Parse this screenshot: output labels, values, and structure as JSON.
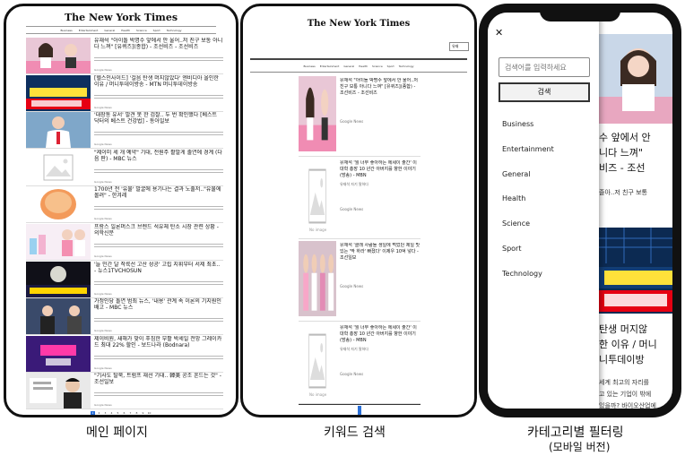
{
  "colors": {
    "accent": "#2a6fd8",
    "frame": "#111111"
  },
  "captions": {
    "screen1": "메인 페이지",
    "screen2": "키워드 검색",
    "screen3_line1": "카테고리별 필터링",
    "screen3_line2": "(모바일 버전)"
  },
  "screen1": {
    "logo": "The New York Times",
    "nav": [
      "Business",
      "Entertainment",
      "General",
      "Health",
      "Science",
      "Sport",
      "Technology"
    ],
    "articles": [
      {
        "title": "유재석 \"아이돌 박명수 앞에서 안 울어..저 친구 보통 아니다 느껴\" [유퀴즈](종합) - 조선비즈 - 조선비즈",
        "thumb": "people-pink",
        "source": "Google News"
      },
      {
        "title": "[헬스인사이드] '걸음 탄생 머지않았다' 엔비디아 올인한 이유 / 머니투데이방송 - MTN 머니투데이방송",
        "thumb": "banner-blue",
        "source": "Google News"
      },
      {
        "title": "'대장동 유서' 발견 못 한 검찰.. 두 번 확인했다 [베스트 닥터의 베스트 건강법] - 동아일보",
        "thumb": "doctor",
        "source": "Google News"
      },
      {
        "title": "\"제이미 세 개 예약\" 기대, 전원주 활발게 출연에 경계 (다음 판) - MBC 뉴스",
        "thumb": "no-image",
        "source": "Google News"
      },
      {
        "title": "1700년 전 '유물' 발굴에 용기나는 결과 노출저..\"유물에 몰려\" - 한겨레",
        "thumb": "orange-disc",
        "source": "Google News"
      },
      {
        "title": "프랑스 일론머스크 브렌드 석유체 탄소 시장 관련 상황 - 의학신문",
        "thumb": "lab",
        "source": "Google News"
      },
      {
        "title": "'늘 민간 달 착륙선 고산 성공' 고립 지휘부터 서제 최초.. - 뉴스1TVCHOSUN",
        "thumb": "moon",
        "source": "Google News"
      },
      {
        "title": "가정인당 돌연 범죄 뉴스, '내용' 관계 속 이론의 기지원인 배고 - MBC 뉴스",
        "thumb": "anchor",
        "source": "Google News"
      },
      {
        "title": "제이비원, 새해가 맞이 푸짐한 부활 박세일 전망 그레이카드 최대 22% 할인 - 보드나라 (Bodnara)",
        "thumb": "sale",
        "source": "Google News"
      },
      {
        "title": "\"기사도 탈북, 트럼프 재선 기대.. 韓美 공조 흔드는 것\" - 조선일보",
        "thumb": "kim",
        "source": "Google News"
      }
    ],
    "pages": [
      "1",
      "2",
      "3",
      "4",
      "5",
      "6",
      "7",
      "8",
      "9",
      "10"
    ],
    "active_page": "1"
  },
  "screen2": {
    "logo": "The New York Times",
    "search_value": "유재",
    "nav": [
      "Business",
      "Entertainment",
      "General",
      "Health",
      "Science",
      "Sport",
      "Technology"
    ],
    "results": [
      {
        "title": "유재석 \"아이돌 박명수 앞에서 안 울어..저 친구 보통 아니다 느껴\" [유퀴즈](종합) - 조선비즈 - 조선비즈",
        "source": "Google News",
        "desc": "",
        "thumb": "people-pink",
        "caption": ""
      },
      {
        "title": "유재석 '뭘 너무 좋아하는 에세이 출간' 이대학 총장 10 년간 아버지를 향한 이야기 (방송) - MBN",
        "source": "Google News",
        "desc": "유재석 자기\n말하다",
        "thumb": "no-image",
        "caption": "No image"
      },
      {
        "title": "유재석 '클래 사람들 생일에 먹었던 제일 맛있는 '딱 하라' 빠졌다' 이제우 10억 넣다 - 조선일보",
        "source": "Google News",
        "desc": "",
        "thumb": "group",
        "caption": ""
      },
      {
        "title": "유재석 '뭘 너무 좋아하는 에세이 출간' 이대학 총장 10 년간 아버지를 향한 이야기 (방송) - MBN",
        "source": "Google News",
        "desc": "유재석 자기\n말하다",
        "thumb": "no-image",
        "caption": "No image"
      }
    ]
  },
  "phone": {
    "search_placeholder": "검색어를 입력하세요",
    "search_button": "검색",
    "close_icon": "✕",
    "categories": [
      "Business",
      "Entertainment",
      "General",
      "Health",
      "Science",
      "Sport",
      "Technology"
    ],
    "behind_text": {
      "line1": "수 앞에서 안",
      "line2": "니다 느껴\"",
      "line3": "비즈 - 조선",
      "small1": "졸아..저 친구 보통",
      "line4": "탄생 머지않",
      "line5": "한 이유 / 머니",
      "line6": "니투데이방",
      "small2": "세계 최고의 자리를",
      "small3": "고 있는 기업이 밖에",
      "small4": "있을까? 바이오산업에"
    }
  }
}
